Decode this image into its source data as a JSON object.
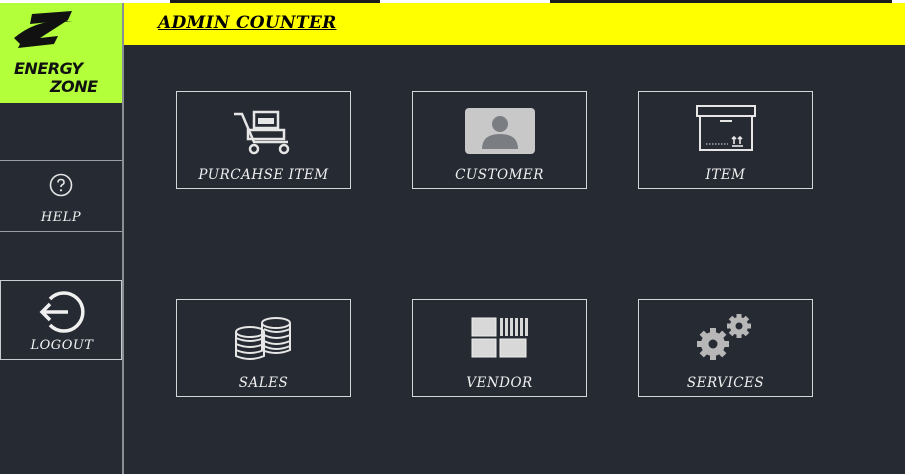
{
  "header": {
    "title": "ADMIN COUNTER"
  },
  "logo": {
    "line1": "ENERGY",
    "line2": "ZONE"
  },
  "sidebar": {
    "help_label": "HELP",
    "logout_label": "LOGOUT"
  },
  "tiles": [
    {
      "label": "PURCAHSE ITEM",
      "icon": "trolley-icon"
    },
    {
      "label": "CUSTOMER",
      "icon": "customer-icon"
    },
    {
      "label": "ITEM",
      "icon": "box-icon"
    },
    {
      "label": "SALES",
      "icon": "coins-icon"
    },
    {
      "label": "VENDOR",
      "icon": "vendor-icon"
    },
    {
      "label": "SERVICES",
      "icon": "gears-icon"
    }
  ],
  "colors": {
    "background": "#262a33",
    "header": "#ffff00",
    "logo_bg": "#b2ff3a"
  }
}
